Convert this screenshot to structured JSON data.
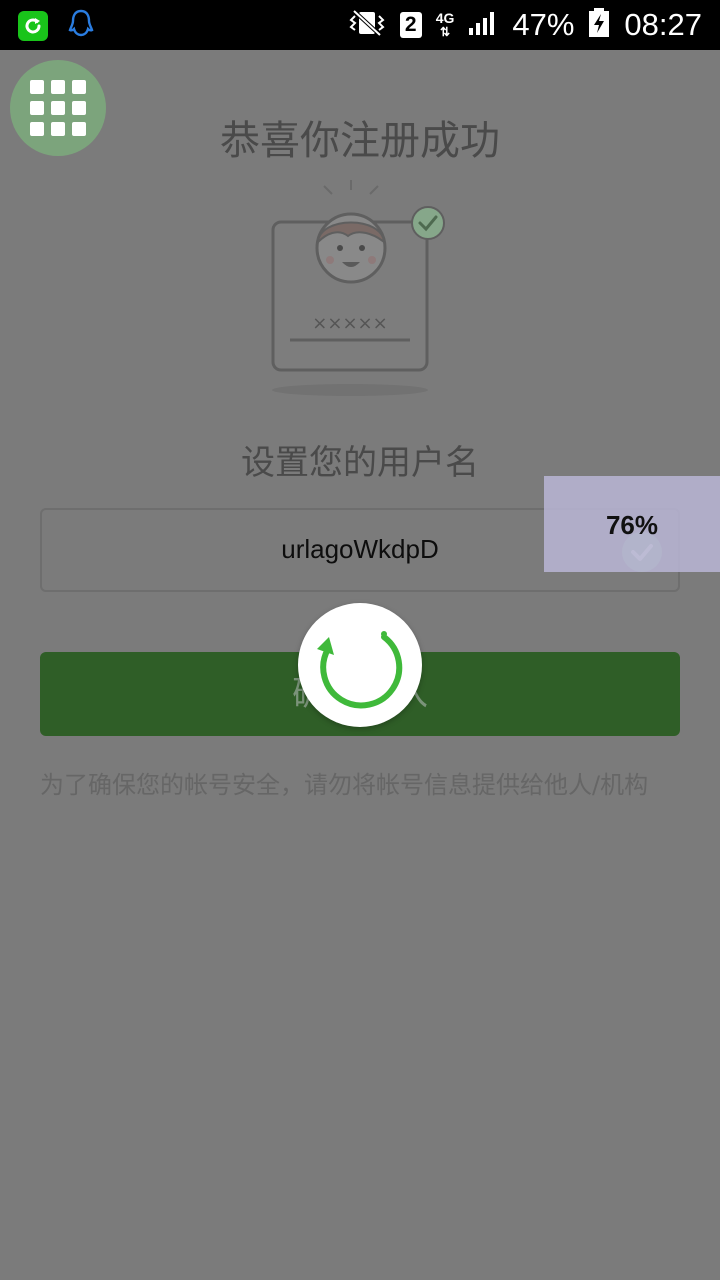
{
  "status_bar": {
    "sim_slot": "2",
    "network_type": "4G",
    "battery": "47%",
    "time": "08:27",
    "icons": [
      "refresh-app-icon",
      "qq-icon",
      "vibrate-icon",
      "signal-icon",
      "battery-icon"
    ]
  },
  "page": {
    "title": "恭喜你注册成功",
    "password_mask": "×××××",
    "subtitle": "设置您的用户名",
    "username_value": "urlagoWkdpD",
    "confirm_label": "确认进入",
    "notice": "为了确保您的帐号安全，请勿将帐号信息提供给他人/机构"
  },
  "overlay": {
    "progress_label": "76%",
    "progress_value": 0.76
  },
  "colors": {
    "dim_background": "#7b7b7b",
    "button_green": "#2f5e27",
    "spinner_green": "#3fb93a",
    "assistive_green": "#7ca47c"
  }
}
